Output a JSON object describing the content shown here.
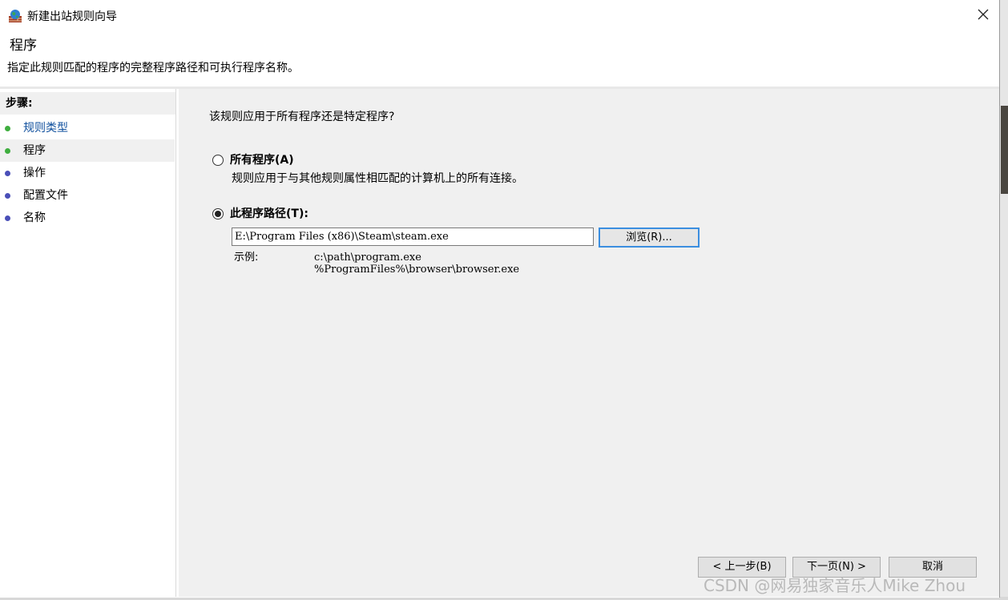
{
  "window": {
    "title": "新建出站规则向导",
    "close_glyph": "✕"
  },
  "header": {
    "title": "程序",
    "description": "指定此规则匹配的程序的完整程序路径和可执行程序名称。"
  },
  "steps": {
    "title": "步骤:",
    "items": [
      {
        "label": "规则类型",
        "dot_color": "#3fae3f"
      },
      {
        "label": "程序",
        "dot_color": "#3fae3f"
      },
      {
        "label": "操作",
        "dot_color": "#4a4fb8"
      },
      {
        "label": "配置文件",
        "dot_color": "#4a4fb8"
      },
      {
        "label": "名称",
        "dot_color": "#4a4fb8"
      }
    ]
  },
  "content": {
    "question": "该规则应用于所有程序还是特定程序?",
    "all_programs": {
      "label": "所有程序(A)",
      "description": "规则应用于与其他规则属性相匹配的计算机上的所有连接。",
      "checked": false
    },
    "this_program": {
      "label": "此程序路径(T):",
      "checked": true,
      "path_value": "E:\\Program Files (x86)\\Steam\\steam.exe",
      "browse_label": "浏览(R)..."
    },
    "example": {
      "label": "示例:",
      "line1": "c:\\path\\program.exe",
      "line2": "%ProgramFiles%\\browser\\browser.exe"
    }
  },
  "buttons": {
    "back": "< 上一步(B)",
    "next": "下一页(N) >",
    "cancel": "取消"
  },
  "watermark": "CSDN @网易独家音乐人Mike Zhou"
}
